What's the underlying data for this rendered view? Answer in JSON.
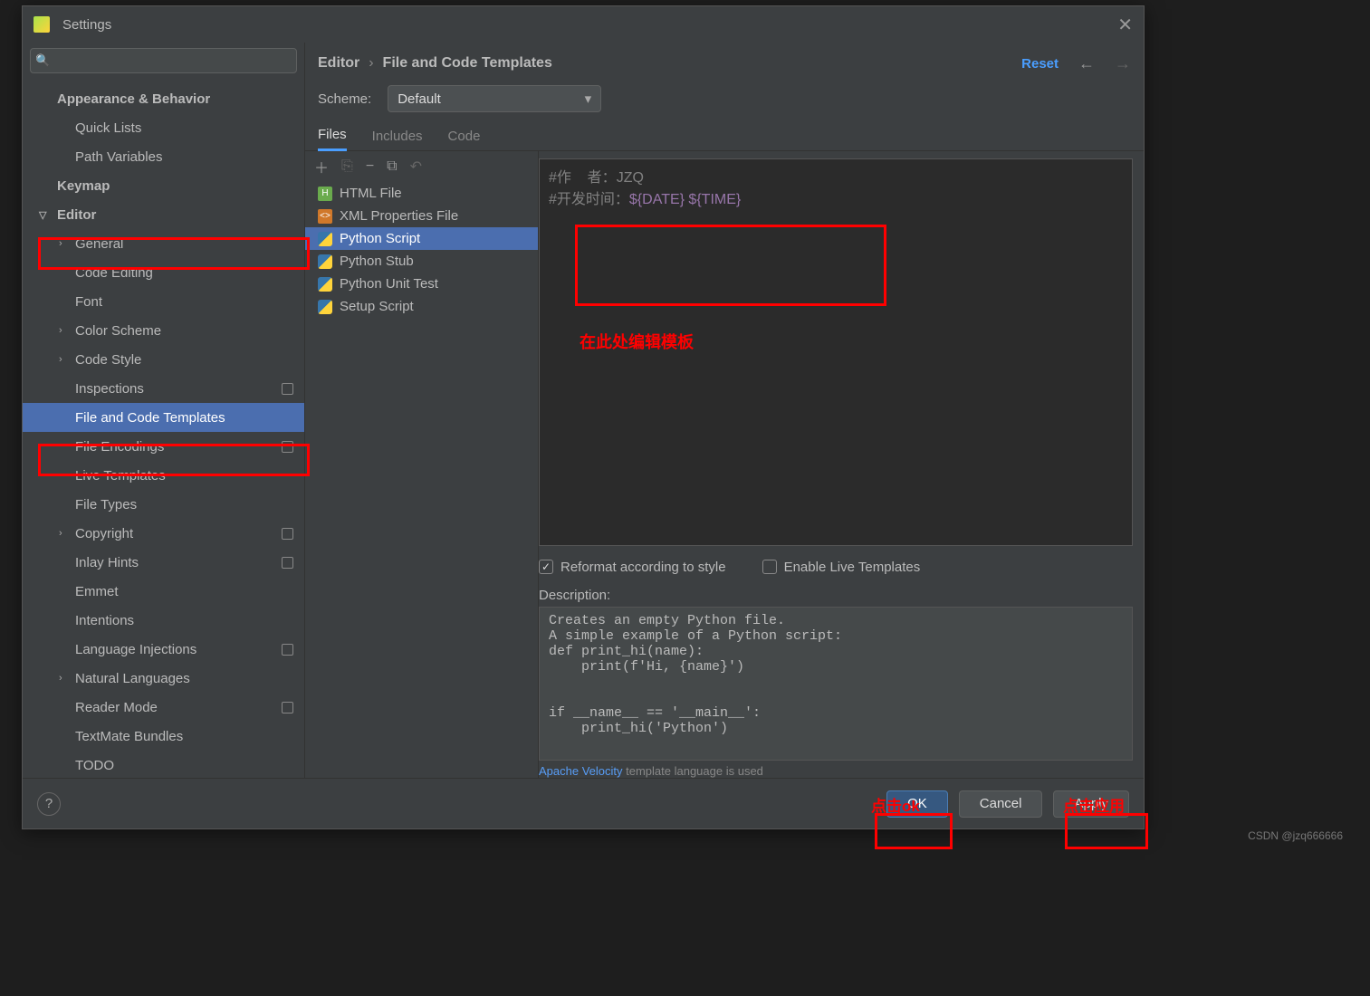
{
  "window": {
    "title": "Settings"
  },
  "search": {
    "placeholder": ""
  },
  "nav": {
    "appearance": "Appearance & Behavior",
    "quick_lists": "Quick Lists",
    "path_vars": "Path Variables",
    "keymap": "Keymap",
    "editor": "Editor",
    "general": "General",
    "code_editing": "Code Editing",
    "font": "Font",
    "color_scheme": "Color Scheme",
    "code_style": "Code Style",
    "inspections": "Inspections",
    "file_code_templates": "File and Code Templates",
    "file_encodings": "File Encodings",
    "live_templates": "Live Templates",
    "file_types": "File Types",
    "copyright": "Copyright",
    "inlay_hints": "Inlay Hints",
    "emmet": "Emmet",
    "intentions": "Intentions",
    "language_injections": "Language Injections",
    "natural_languages": "Natural Languages",
    "reader_mode": "Reader Mode",
    "textmate": "TextMate Bundles",
    "todo": "TODO"
  },
  "breadcrumb": {
    "a": "Editor",
    "b": "File and Code Templates",
    "reset": "Reset"
  },
  "scheme": {
    "label": "Scheme:",
    "value": "Default"
  },
  "tabs": {
    "files": "Files",
    "includes": "Includes",
    "code": "Code"
  },
  "templates": {
    "items": [
      {
        "icon": "html",
        "label": "HTML File"
      },
      {
        "icon": "xml",
        "label": "XML Properties File"
      },
      {
        "icon": "py",
        "label": "Python Script",
        "selected": true
      },
      {
        "icon": "py",
        "label": "Python Stub"
      },
      {
        "icon": "py",
        "label": "Python Unit Test"
      },
      {
        "icon": "py",
        "label": "Setup Script"
      }
    ]
  },
  "code": {
    "line1_prefix": "#作    者：",
    "line1_value": "JZQ",
    "line2_prefix": "#开发时间：",
    "line2_var": "${DATE} ${TIME}"
  },
  "checks": {
    "reformat": "Reformat according to style",
    "live": "Enable Live Templates"
  },
  "description": {
    "label": "Description:",
    "text": "Creates an empty Python file.\nA simple example of a Python script:\ndef print_hi(name):\n    print(f'Hi, {name}')\n\n\nif __name__ == '__main__':\n    print_hi('Python')"
  },
  "langnote": {
    "link": "Apache Velocity",
    "rest": " template language is used"
  },
  "buttons": {
    "ok": "OK",
    "cancel": "Cancel",
    "apply": "Apply"
  },
  "annotations": {
    "template_hint": "在此处编辑模板",
    "ok_hint": "点击ok",
    "apply_hint": "点击应用"
  },
  "watermark": "CSDN @jzq666666"
}
